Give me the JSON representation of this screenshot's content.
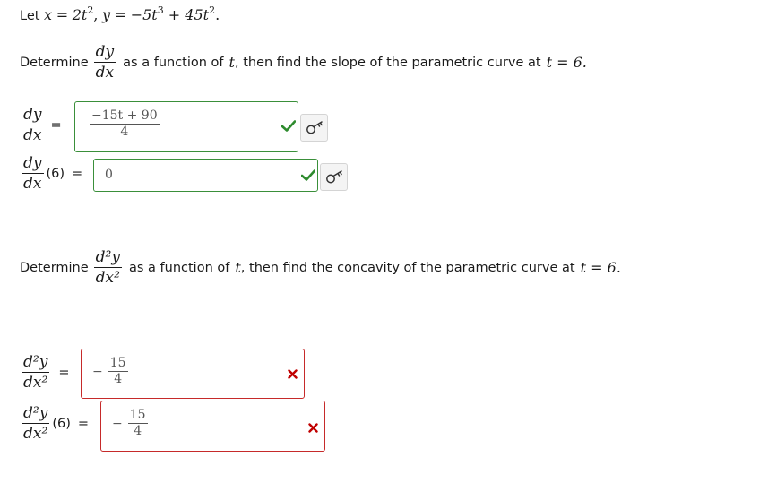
{
  "intro": {
    "prefix": "Let",
    "x_var": "x",
    "equals": "=",
    "x_expr_coef": "2t",
    "x_expr_pow": "2",
    "comma": ",",
    "y_var": "y",
    "y_expr_part1": "−5t",
    "y_expr_pow1": "3",
    "y_expr_part2": " + 45t",
    "y_expr_pow2": "2",
    "period": "."
  },
  "q1": {
    "determine": "Determine",
    "frac_num": "dy",
    "frac_den": "dx",
    "text": "as a function of",
    "t": "t",
    "text2": ", then find the slope of the parametric curve at",
    "cond": "t = 6."
  },
  "q1_rows": [
    {
      "lhs_num": "dy",
      "lhs_den": "dx",
      "arg": "",
      "eq": "=",
      "answer_num": "−15t + 90",
      "answer_den": "4",
      "status": "correct",
      "status_icon": "check-icon"
    },
    {
      "lhs_num": "dy",
      "lhs_den": "dx",
      "arg": "(6)",
      "eq": "=",
      "answer_value": "0",
      "status": "correct",
      "status_icon": "check-icon"
    }
  ],
  "q2": {
    "determine": "Determine",
    "frac_num": "d²y",
    "frac_den": "dx²",
    "text": "as a function of",
    "t": "t",
    "text2": ", then find the concavity of the parametric curve at",
    "cond": "t = 6."
  },
  "q2_rows": [
    {
      "lhs_num": "d²y",
      "lhs_den": "dx²",
      "arg": "",
      "eq": "=",
      "answer_sign": "−",
      "answer_num": "15",
      "answer_den": "4",
      "status": "incorrect",
      "status_icon": "x-icon"
    },
    {
      "lhs_num": "d²y",
      "lhs_den": "dx²",
      "arg": "(6)",
      "eq": "=",
      "answer_sign": "−",
      "answer_num": "15",
      "answer_den": "4",
      "status": "incorrect",
      "status_icon": "x-icon"
    }
  ],
  "colors": {
    "correct": "#3a8f3a",
    "incorrect": "#c62a2a",
    "check": "#2e8b2e",
    "cross": "#c00000"
  },
  "icons": {
    "key_button": "key-icon"
  }
}
